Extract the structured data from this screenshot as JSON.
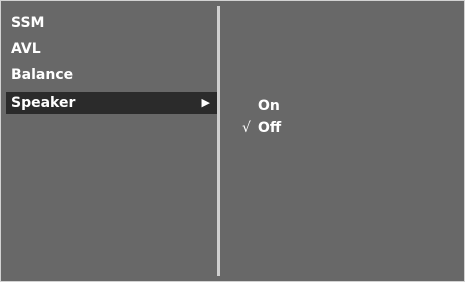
{
  "menu": {
    "items": [
      {
        "label": "SSM"
      },
      {
        "label": "AVL"
      },
      {
        "label": "Balance"
      },
      {
        "label": "Speaker",
        "arrow": "▶"
      }
    ],
    "selected_index": 3
  },
  "submenu": {
    "options": [
      {
        "label": "On",
        "checked": false
      },
      {
        "label": "Off",
        "checked": true,
        "check_mark": "√"
      }
    ]
  },
  "colors": {
    "panel_background": "#686868",
    "selected_background": "#2b2b2b",
    "text": "#ffffff",
    "divider": "#cfcfcf"
  }
}
